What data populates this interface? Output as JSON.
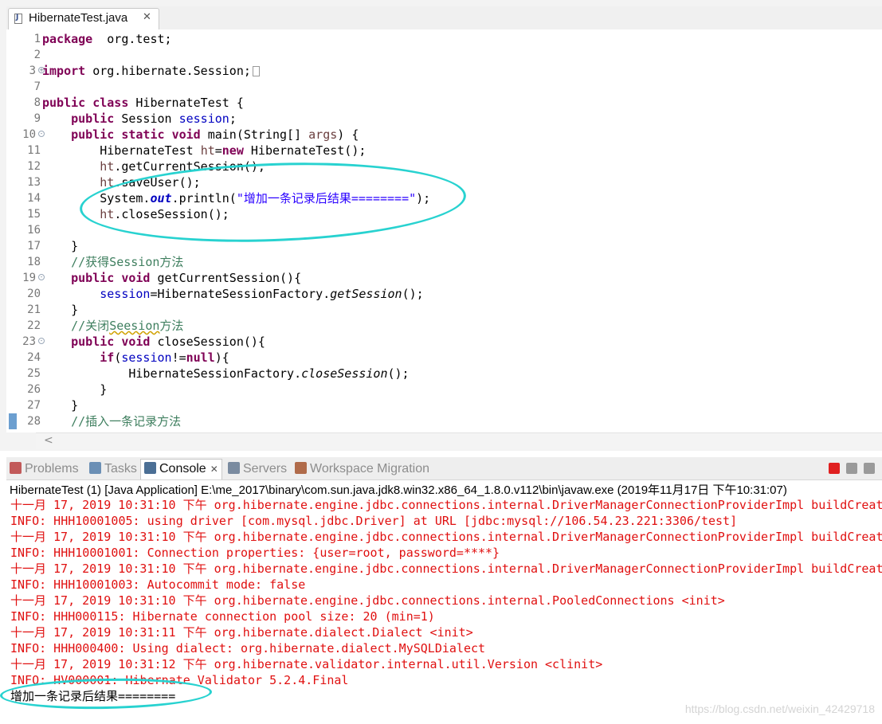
{
  "editor": {
    "tab": {
      "title": "HibernateTest.java",
      "close": "✕"
    },
    "lines": [
      {
        "n": "1",
        "fold": "",
        "segs": [
          [
            "kw",
            "package"
          ],
          [
            "",
            "  org.test;"
          ]
        ]
      },
      {
        "n": "2",
        "fold": "",
        "segs": []
      },
      {
        "n": "3",
        "fold": "+",
        "segs": [
          [
            "kw",
            "import"
          ],
          [
            "",
            " org.hibernate.Session;"
          ]
        ],
        "collapsed": true
      },
      {
        "n": "7",
        "fold": "",
        "segs": []
      },
      {
        "n": "8",
        "fold": "",
        "segs": [
          [
            "kw",
            "public"
          ],
          [
            "",
            " "
          ],
          [
            "kw",
            "class"
          ],
          [
            "",
            " HibernateTest {"
          ]
        ]
      },
      {
        "n": "9",
        "fold": "",
        "segs": [
          [
            "",
            "    "
          ],
          [
            "kw",
            "public"
          ],
          [
            "",
            " Session "
          ],
          [
            "fld",
            "session"
          ],
          [
            "",
            ";"
          ]
        ]
      },
      {
        "n": "10",
        "fold": "-",
        "segs": [
          [
            "",
            "    "
          ],
          [
            "kw",
            "public"
          ],
          [
            "",
            " "
          ],
          [
            "kw",
            "static"
          ],
          [
            "",
            " "
          ],
          [
            "kw",
            "void"
          ],
          [
            "",
            " main(String[] "
          ],
          [
            "loc",
            "args"
          ],
          [
            "",
            ") {"
          ]
        ]
      },
      {
        "n": "11",
        "fold": "",
        "segs": [
          [
            "",
            "        HibernateTest "
          ],
          [
            "loc",
            "ht"
          ],
          [
            "",
            "="
          ],
          [
            "kw",
            "new"
          ],
          [
            "",
            " HibernateTest();"
          ]
        ]
      },
      {
        "n": "12",
        "fold": "",
        "segs": [
          [
            "",
            "        "
          ],
          [
            "loc",
            "ht"
          ],
          [
            "",
            ".getCurrentSession();"
          ]
        ]
      },
      {
        "n": "13",
        "fold": "",
        "segs": [
          [
            "",
            "        "
          ],
          [
            "loc",
            "ht"
          ],
          [
            "",
            ".saveUser();"
          ]
        ]
      },
      {
        "n": "14",
        "fold": "",
        "segs": [
          [
            "",
            "        System."
          ],
          [
            "sf",
            "out"
          ],
          [
            "",
            ".println("
          ],
          [
            "str",
            "\"增加一条记录后结果========\""
          ],
          [
            "",
            ");"
          ]
        ]
      },
      {
        "n": "15",
        "fold": "",
        "segs": [
          [
            "",
            "        "
          ],
          [
            "loc",
            "ht"
          ],
          [
            "",
            ".closeSession();"
          ]
        ]
      },
      {
        "n": "16",
        "fold": "",
        "segs": []
      },
      {
        "n": "17",
        "fold": "",
        "segs": [
          [
            "",
            "    }"
          ]
        ]
      },
      {
        "n": "18",
        "fold": "",
        "segs": [
          [
            "",
            "    "
          ],
          [
            "cm",
            "//获得Session方法"
          ]
        ]
      },
      {
        "n": "19",
        "fold": "-",
        "segs": [
          [
            "",
            "    "
          ],
          [
            "kw",
            "public"
          ],
          [
            "",
            " "
          ],
          [
            "kw",
            "void"
          ],
          [
            "",
            " getCurrentSession(){"
          ]
        ]
      },
      {
        "n": "20",
        "fold": "",
        "segs": [
          [
            "",
            "        "
          ],
          [
            "fld",
            "session"
          ],
          [
            "",
            "=HibernateSessionFactory."
          ],
          [
            "it",
            "getSession"
          ],
          [
            "",
            "();"
          ]
        ]
      },
      {
        "n": "21",
        "fold": "",
        "segs": [
          [
            "",
            "    }"
          ]
        ]
      },
      {
        "n": "22",
        "fold": "",
        "segs": [
          [
            "",
            "    "
          ],
          [
            "cm",
            "//关闭"
          ],
          [
            "cm squiggle",
            "Seesion"
          ],
          [
            "cm",
            "方法"
          ]
        ]
      },
      {
        "n": "23",
        "fold": "-",
        "segs": [
          [
            "",
            "    "
          ],
          [
            "kw",
            "public"
          ],
          [
            "",
            " "
          ],
          [
            "kw",
            "void"
          ],
          [
            "",
            " closeSession(){"
          ]
        ]
      },
      {
        "n": "24",
        "fold": "",
        "segs": [
          [
            "",
            "        "
          ],
          [
            "kw",
            "if"
          ],
          [
            "",
            "("
          ],
          [
            "fld",
            "session"
          ],
          [
            "",
            "!="
          ],
          [
            "kw",
            "null"
          ],
          [
            "",
            "){"
          ]
        ]
      },
      {
        "n": "25",
        "fold": "",
        "segs": [
          [
            "",
            "            HibernateSessionFactory."
          ],
          [
            "it",
            "closeSession"
          ],
          [
            "",
            "();"
          ]
        ]
      },
      {
        "n": "26",
        "fold": "",
        "segs": [
          [
            "",
            "        }"
          ]
        ]
      },
      {
        "n": "27",
        "fold": "",
        "segs": [
          [
            "",
            "    }"
          ]
        ]
      },
      {
        "n": "28",
        "fold": "",
        "segs": [
          [
            "",
            "    "
          ],
          [
            "cm",
            "//插入一条记录方法"
          ]
        ],
        "marker": true
      }
    ],
    "scroll_arrow": "<"
  },
  "console": {
    "tabs": [
      {
        "label": "Problems",
        "icon": "problems-icon",
        "color": "#c25a5a",
        "active": false
      },
      {
        "label": "Tasks",
        "icon": "tasks-icon",
        "color": "#6b8fb5",
        "active": false
      },
      {
        "label": "Console",
        "icon": "console-icon",
        "color": "#4b6f95",
        "active": true,
        "close": "✕"
      },
      {
        "label": "Servers",
        "icon": "servers-icon",
        "color": "#7a8ba0",
        "active": false
      },
      {
        "label": "Workspace Migration",
        "icon": "migration-icon",
        "color": "#b06b4a",
        "active": false
      }
    ],
    "launch_title": "HibernateTest (1) [Java Application] E:\\me_2017\\binary\\com.sun.java.jdk8.win32.x86_64_1.8.0.v112\\bin\\javaw.exe (2019年11月17日 下午10:31:07)",
    "lines": [
      {
        "kind": "err",
        "text": "十一月 17, 2019 10:31:10 下午 org.hibernate.engine.jdbc.connections.internal.DriverManagerConnectionProviderImpl buildCreat"
      },
      {
        "kind": "err",
        "text": "INFO: HHH10001005: using driver [com.mysql.jdbc.Driver] at URL [jdbc:mysql://106.54.23.221:3306/test]"
      },
      {
        "kind": "err",
        "text": "十一月 17, 2019 10:31:10 下午 org.hibernate.engine.jdbc.connections.internal.DriverManagerConnectionProviderImpl buildCreat"
      },
      {
        "kind": "err",
        "text": "INFO: HHH10001001: Connection properties: {user=root, password=****}"
      },
      {
        "kind": "err",
        "text": "十一月 17, 2019 10:31:10 下午 org.hibernate.engine.jdbc.connections.internal.DriverManagerConnectionProviderImpl buildCreat"
      },
      {
        "kind": "err",
        "text": "INFO: HHH10001003: Autocommit mode: false"
      },
      {
        "kind": "err",
        "text": "十一月 17, 2019 10:31:10 下午 org.hibernate.engine.jdbc.connections.internal.PooledConnections <init>"
      },
      {
        "kind": "err",
        "text": "INFO: HHH000115: Hibernate connection pool size: 20 (min=1)"
      },
      {
        "kind": "err",
        "text": "十一月 17, 2019 10:31:11 下午 org.hibernate.dialect.Dialect <init>"
      },
      {
        "kind": "err",
        "text": "INFO: HHH000400: Using dialect: org.hibernate.dialect.MySQLDialect"
      },
      {
        "kind": "err",
        "text": "十一月 17, 2019 10:31:12 下午 org.hibernate.validator.internal.util.Version <clinit>"
      },
      {
        "kind": "err",
        "text": "INFO: HV000001: Hibernate Validator 5.2.4.Final"
      },
      {
        "kind": "std",
        "text": "增加一条记录后结果========"
      }
    ],
    "watermark": "https://blog.csdn.net/weixin_42429718"
  },
  "colors": {
    "keyword": "#7f0055",
    "field": "#0000c0",
    "string": "#2a00ff",
    "comment": "#3f7f5f",
    "stderr": "#e01010",
    "annotation_circle": "#28d2d0"
  }
}
